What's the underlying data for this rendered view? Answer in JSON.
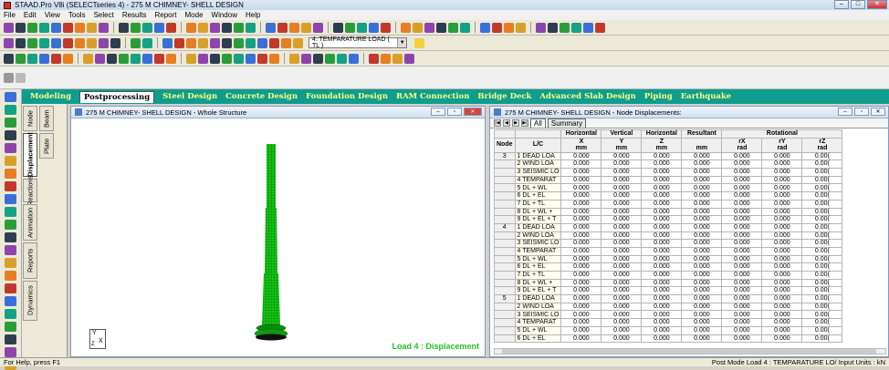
{
  "window_title": "STAAD.Pro V8i (SELECTseries 4) - 275 M CHIMNEY- SHELL DESIGN",
  "menu": [
    "File",
    "Edit",
    "View",
    "Tools",
    "Select",
    "Results",
    "Report",
    "Mode",
    "Window",
    "Help"
  ],
  "load_case_dropdown": "4: TEMPARATURE LOAD ( TL )",
  "mode_tabs": [
    "Modeling",
    "Postprocessing",
    "Steel Design",
    "Concrete Design",
    "Foundation Design",
    "RAM Connection",
    "Bridge Deck",
    "Advanced Slab Design",
    "Piping",
    "Earthquake"
  ],
  "active_mode_tab": "Postprocessing",
  "page_tabs_col1": [
    "Node",
    "Displacement",
    "Reactions",
    "Animation",
    "Reports",
    "Dynamics"
  ],
  "page_tabs_col2": [
    "Beam",
    "Plate"
  ],
  "view_window": {
    "title": "275 M CHIMNEY- SHELL DESIGN - Whole Structure",
    "load_label": "Load 4 : Displacement"
  },
  "table_window": {
    "title": "275 M CHIMNEY- SHELL DESIGN - Node Displacements:",
    "tabs": [
      "All",
      "Summary"
    ],
    "group_headers": [
      "",
      "",
      "Horizontal",
      "Vertical",
      "Horizontal",
      "Resultant",
      "Rotational"
    ],
    "col_headers": [
      "Node",
      "L/C",
      "X",
      "Y",
      "Z",
      "",
      "rX",
      "rY",
      "rZ"
    ],
    "unit_headers": [
      "",
      "",
      "mm",
      "mm",
      "mm",
      "mm",
      "rad",
      "rad",
      "rad"
    ],
    "rows": [
      {
        "node": "3",
        "lc": "1 DEAD LOA"
      },
      {
        "node": "",
        "lc": "2 WIND LOA"
      },
      {
        "node": "",
        "lc": "3 SEISMIC LO"
      },
      {
        "node": "",
        "lc": "4 TEMPARAT"
      },
      {
        "node": "",
        "lc": "5 DL + WL"
      },
      {
        "node": "",
        "lc": "6 DL + EL"
      },
      {
        "node": "",
        "lc": "7 DL + TL"
      },
      {
        "node": "",
        "lc": "8 DL + WL +"
      },
      {
        "node": "",
        "lc": "9 DL + EL + T"
      },
      {
        "node": "4",
        "lc": "1 DEAD LOA"
      },
      {
        "node": "",
        "lc": "2 WIND LOA"
      },
      {
        "node": "",
        "lc": "3 SEISMIC LO"
      },
      {
        "node": "",
        "lc": "4 TEMPARAT"
      },
      {
        "node": "",
        "lc": "5 DL + WL"
      },
      {
        "node": "",
        "lc": "6 DL + EL"
      },
      {
        "node": "",
        "lc": "7 DL + TL"
      },
      {
        "node": "",
        "lc": "8 DL + WL +"
      },
      {
        "node": "",
        "lc": "9 DL + EL + T"
      },
      {
        "node": "5",
        "lc": "1 DEAD LOA"
      },
      {
        "node": "",
        "lc": "2 WIND LOA"
      },
      {
        "node": "",
        "lc": "3 SEISMIC LO"
      },
      {
        "node": "",
        "lc": "4 TEMPARAT"
      },
      {
        "node": "",
        "lc": "5 DL + WL"
      },
      {
        "node": "",
        "lc": "6 DL + EL"
      }
    ],
    "cell_value": "0.000",
    "rz_value": "0.00("
  },
  "status": {
    "left": "For Help, press F1",
    "right": "Post Mode     Load 4 : TEMPARATURE LO/ Input Units : kN"
  },
  "icon_colors": [
    "#3a6fd8",
    "#d8a02a",
    "#2a9d3a",
    "#c0392b",
    "#8e44ad",
    "#16a085",
    "#e67e22",
    "#2c3e50"
  ]
}
